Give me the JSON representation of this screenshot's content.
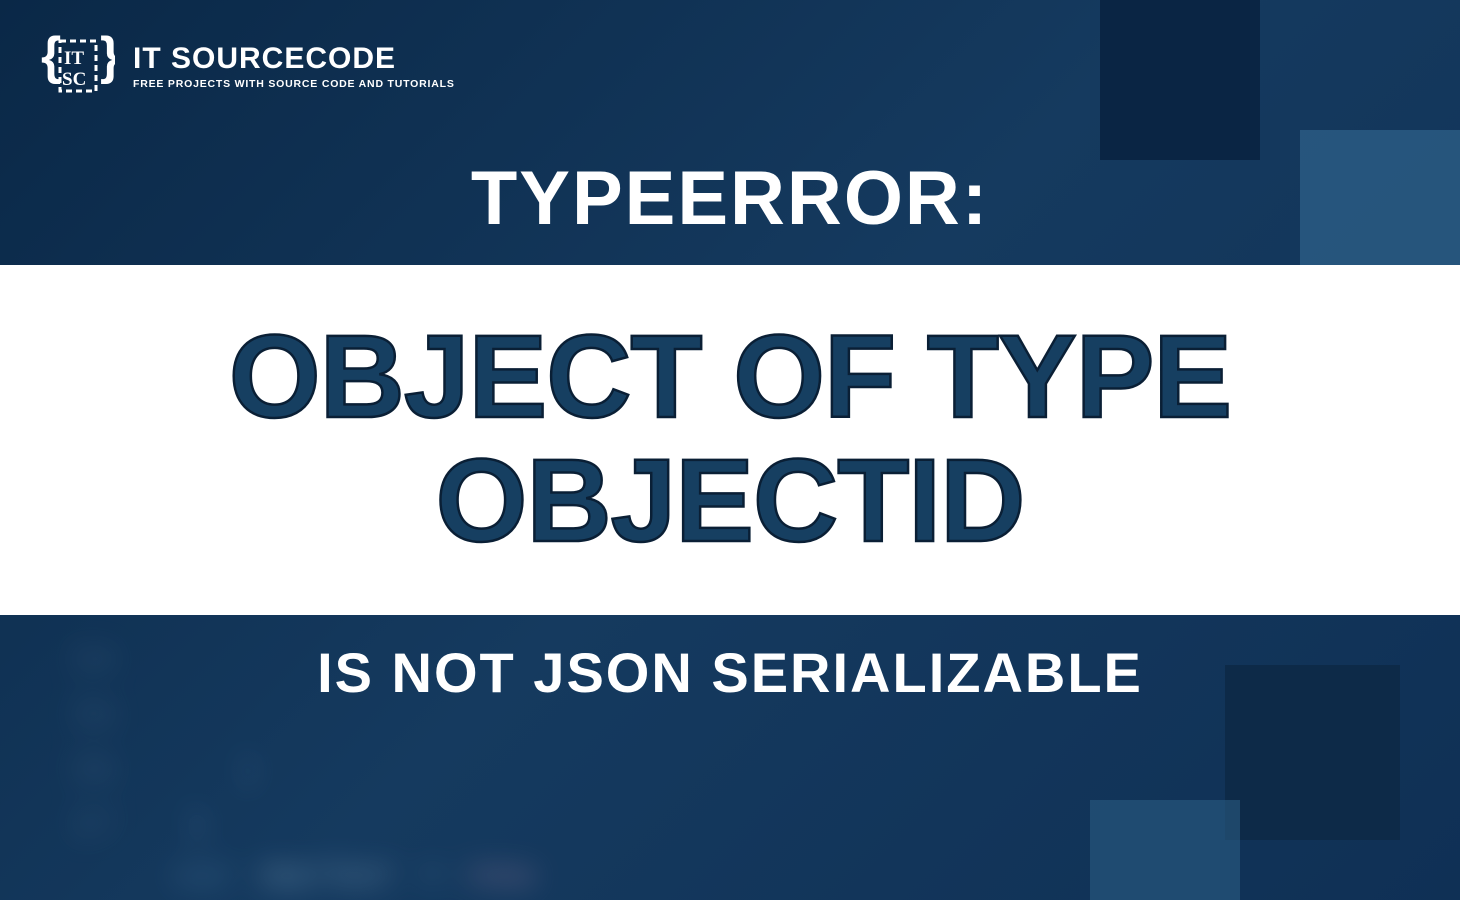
{
  "logo": {
    "title": "IT SOURCECODE",
    "tagline": "FREE PROJECTS WITH SOURCE CODE AND TUTORIALS"
  },
  "heading_top": "TYPEERROR:",
  "main_title_line1": "OBJECT OF TYPE",
  "main_title_line2": "OBJECTID",
  "heading_bottom": "IS NOT JSON SERIALIZABLE",
  "colors": {
    "bg_dark": "#0a2847",
    "bg_mid": "#153a5f",
    "text_navy": "#163f61",
    "white": "#ffffff"
  },
  "bg_code_lines": [
    {
      "num": "34",
      "text": ""
    },
    {
      "num": "35",
      "text": ""
    },
    {
      "num": "36",
      "text": ")"
    },
    {
      "num": "37",
      "text": "}"
    }
  ]
}
